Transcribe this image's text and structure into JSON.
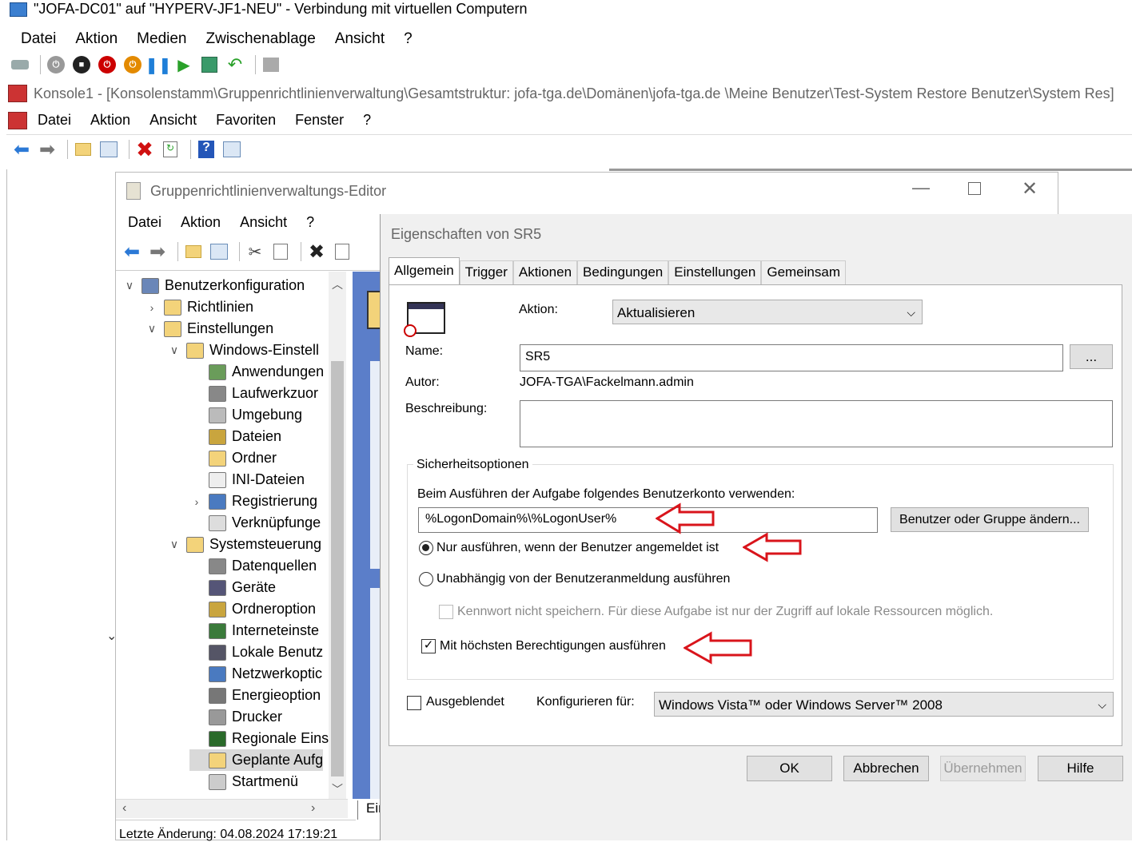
{
  "vm_window": {
    "title": "\"JOFA-DC01\" auf \"HYPERV-JF1-NEU\" - Verbindung mit virtuellen Computern",
    "menu": [
      "Datei",
      "Aktion",
      "Medien",
      "Zwischenablage",
      "Ansicht",
      "?"
    ]
  },
  "console": {
    "title": "Konsole1 - [Konsolenstamm\\Gruppenrichtlinienverwaltung\\Gesamtstruktur: jofa-tga.de\\Domänen\\jofa-tga.de \\Meine Benutzer\\Test-System Restore Benutzer\\System Res]",
    "menu": [
      "Datei",
      "Aktion",
      "Ansicht",
      "Favoriten",
      "Fenster",
      "?"
    ]
  },
  "gpe": {
    "title": "Gruppenrichtlinienverwaltungs-Editor",
    "menu": [
      "Datei",
      "Aktion",
      "Ansicht",
      "?"
    ],
    "tree": [
      {
        "label": "Benutzerkonfiguration",
        "chev": "∨"
      },
      {
        "label": "Richtlinien",
        "chev": "›"
      },
      {
        "label": "Einstellungen",
        "chev": "∨"
      },
      {
        "label": "Windows-Einstell",
        "chev": "∨"
      },
      {
        "label": "Anwendungen",
        "chev": ""
      },
      {
        "label": "Laufwerkzuor",
        "chev": ""
      },
      {
        "label": "Umgebung",
        "chev": ""
      },
      {
        "label": "Dateien",
        "chev": ""
      },
      {
        "label": "Ordner",
        "chev": ""
      },
      {
        "label": "INI-Dateien",
        "chev": ""
      },
      {
        "label": "Registrierung",
        "chev": "›"
      },
      {
        "label": "Verknüpfunge",
        "chev": ""
      },
      {
        "label": "Systemsteuerung",
        "chev": "∨"
      },
      {
        "label": "Datenquellen",
        "chev": ""
      },
      {
        "label": "Geräte",
        "chev": ""
      },
      {
        "label": "Ordneroption",
        "chev": ""
      },
      {
        "label": "Interneteinste",
        "chev": ""
      },
      {
        "label": "Lokale Benutz",
        "chev": ""
      },
      {
        "label": "Netzwerkoptic",
        "chev": ""
      },
      {
        "label": "Energieoption",
        "chev": ""
      },
      {
        "label": "Drucker",
        "chev": ""
      },
      {
        "label": "Regionale Eins",
        "chev": ""
      },
      {
        "label": "Geplante Aufg",
        "chev": ""
      },
      {
        "label": "Startmenü",
        "chev": ""
      }
    ],
    "status": "Letzte Änderung: 04.08.2024 17:19:21",
    "right_tab": "Eir"
  },
  "dialog": {
    "title": "Eigenschaften von SR5",
    "tabs": [
      "Allgemein",
      "Trigger",
      "Aktionen",
      "Bedingungen",
      "Einstellungen",
      "Gemeinsam"
    ],
    "action_label": "Aktion:",
    "action_value": "Aktualisieren",
    "name_label": "Name:",
    "name_value": "SR5",
    "browse_label": "...",
    "author_label": "Autor:",
    "author_value": "JOFA-TGA\\Fackelmann.admin",
    "description_label": "Beschreibung:",
    "security_group": "Sicherheitsoptionen",
    "account_prompt": "Beim Ausführen der Aufgabe folgendes Benutzerkonto verwenden:",
    "account_value": "%LogonDomain%\\%LogonUser%",
    "change_user_button": "Benutzer oder Gruppe ändern...",
    "radio_logged_on": "Nur ausführen, wenn der Benutzer angemeldet ist",
    "radio_independent": "Unabhängig von der Benutzeranmeldung ausführen",
    "no_password": "Kennwort nicht speichern. Für diese Aufgabe ist nur der Zugriff auf lokale Ressourcen möglich.",
    "highest_priv": "Mit höchsten Berechtigungen ausführen",
    "hidden_label": "Ausgeblendet",
    "configure_label": "Konfigurieren für:",
    "configure_value": "Windows Vista™ oder Windows Server™ 2008",
    "ok": "OK",
    "cancel": "Abbrechen",
    "apply": "Übernehmen",
    "help": "Hilfe"
  },
  "colors": {
    "annotation_arrow": "#d9141b",
    "accent_blue": "#4472c4"
  }
}
